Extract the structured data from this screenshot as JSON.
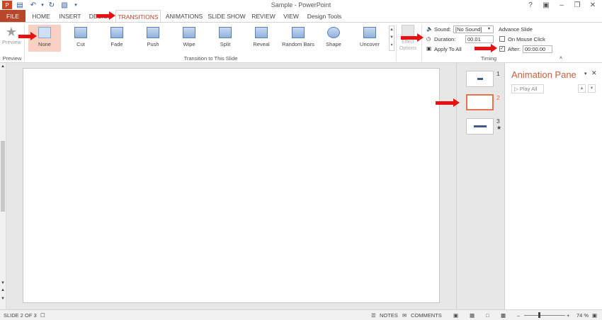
{
  "window": {
    "title": "Sample - PowerPoint"
  },
  "tabs": {
    "file": "FILE",
    "home": "HOME",
    "insert": "INSERT",
    "design": "DESIGN",
    "transitions": "TRANSITIONS",
    "animations": "ANIMATIONS",
    "slideshow": "SLIDE SHOW",
    "review": "REVIEW",
    "view": "VIEW",
    "design_tools": "Design Tools"
  },
  "ribbon": {
    "preview_label": "Preview",
    "preview_group": "Preview",
    "transitions": [
      "None",
      "Cut",
      "Fade",
      "Push",
      "Wipe",
      "Split",
      "Reveal",
      "Random Bars",
      "Shape",
      "Uncover"
    ],
    "transition_group": "Transition to This Slide",
    "effect_options": "Effect Options",
    "sound_label": "Sound:",
    "sound_value": "[No Sound]",
    "duration_label": "Duration:",
    "duration_value": "00.01",
    "apply_all": "Apply To All",
    "advance_title": "Advance Slide",
    "on_mouse_click": "On Mouse Click",
    "after_label": "After:",
    "after_value": "00:00.00",
    "timing_group": "Timing"
  },
  "thumbnails": [
    {
      "num": "1"
    },
    {
      "num": "2"
    },
    {
      "num": "3"
    }
  ],
  "animation_pane": {
    "title": "Animation Pane",
    "play_all": "Play All"
  },
  "status": {
    "slide_info": "SLIDE 2 OF 3",
    "notes": "NOTES",
    "comments": "COMMENTS",
    "zoom": "74 %"
  },
  "colors": {
    "accent": "#b7472a",
    "selected_transition": "#f8d1c2",
    "arrow": "#e81010",
    "current_slide_border": "#e8734f"
  }
}
